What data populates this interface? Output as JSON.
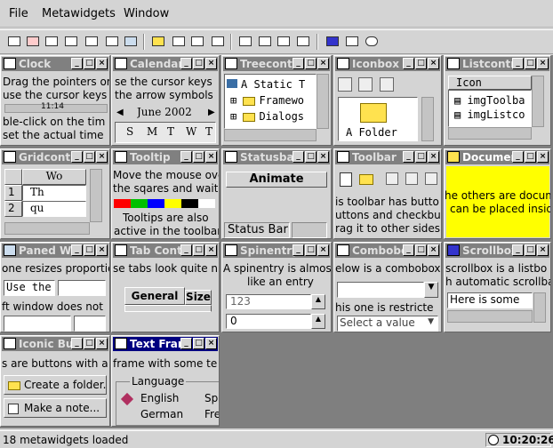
{
  "menu": [
    "File",
    "Metawidgets",
    "Window"
  ],
  "toolbar_icons": [
    "clock-icon",
    "tooltip-icon",
    "statusbar-icon",
    "combobox-icon",
    "spinentry-icon",
    "document-icon",
    "paned-icon",
    "calendar-icon",
    "gridcontrol-icon",
    "textframe-icon",
    "iconic-button-icon",
    "listcontrol-icon",
    "iconbox-icon",
    "treecontrol-icon",
    "tabcontrol-icon",
    "scrollbox-icon",
    "toolbar-widget-icon",
    "clock2-icon"
  ],
  "windows": {
    "clock": {
      "title": "Clock",
      "lines": [
        "Drag the pointers or",
        "use the cursor keys",
        "ble-click on the tim",
        "set the actual time"
      ],
      "scale": "11:14"
    },
    "calendar": {
      "title": "Calendar",
      "lines": [
        "se the cursor keys",
        "the arrow symbols"
      ],
      "month": "June 2002",
      "days": [
        "S",
        "M",
        "T",
        "W",
        "T"
      ]
    },
    "treecontrol": {
      "title": "Treecontr",
      "items": [
        "A Static T",
        "Framewo",
        "Dialogs"
      ]
    },
    "iconbox": {
      "title": "Iconbox",
      "folder_label": "A Folder"
    },
    "listcontrol": {
      "title": "Listcontro",
      "header": "Icon",
      "items": [
        "imgToolba",
        "imgListco"
      ]
    },
    "gridcontrol": {
      "title": "Gridcontr",
      "col_header": "Wo",
      "rows": [
        {
          "num": "1",
          "val": "Th"
        },
        {
          "num": "2",
          "val": "qu"
        }
      ]
    },
    "tooltip": {
      "title": "Tooltip",
      "lines": [
        "Move the mouse ove",
        "the sqares and wait",
        "Tooltips are also",
        "active in the toolbar"
      ],
      "colors": [
        "#ff0000",
        "#00c000",
        "#0000ff",
        "#ffff00",
        "#000000",
        "#ffffff"
      ]
    },
    "statusbar": {
      "title": "Statusba",
      "button": "Animate",
      "status": "Status Bar"
    },
    "toolbar": {
      "title": "Toolbar",
      "lines": [
        "is toolbar has butto",
        "uttons and checkbu",
        "rag it to other sides"
      ]
    },
    "document": {
      "title": "Documen",
      "lines": [
        "he others are docum",
        "can be placed insid"
      ],
      "bg": "#ffff00"
    },
    "paned": {
      "title": "Paned Wi",
      "lines": [
        "one resizes proportio",
        "ft window does not"
      ],
      "field": "Use the"
    },
    "tabcontrol": {
      "title": "Tab Conti",
      "line": "se tabs look quite n",
      "tabs": [
        "General",
        "Size"
      ]
    },
    "spinentry": {
      "title": "Spinentry",
      "lines": [
        "A spinentry is almos",
        "like an entry"
      ],
      "value1": "123",
      "value2": "0"
    },
    "combobox": {
      "title": "Combobo",
      "lines": [
        "elow is a combobox",
        "his one is restricte"
      ],
      "placeholder": "Select a value"
    },
    "scrollbox": {
      "title": "Scrollbox",
      "lines": [
        "scrollbox is a listbo",
        "h automatic scrollba"
      ],
      "entry": "Here is some te"
    },
    "iconicbutton": {
      "title": "Iconic Bu",
      "line": "s are buttons with a",
      "buttons": [
        "Create a folder.",
        "Make a note..."
      ]
    },
    "textframe": {
      "title": "Text Fram",
      "line": "frame with some te",
      "group": "Language",
      "options": [
        "English",
        "Sp",
        "German",
        "Fre"
      ]
    }
  },
  "status": {
    "text": "18 metawidgets loaded",
    "time": "10:20:26"
  }
}
